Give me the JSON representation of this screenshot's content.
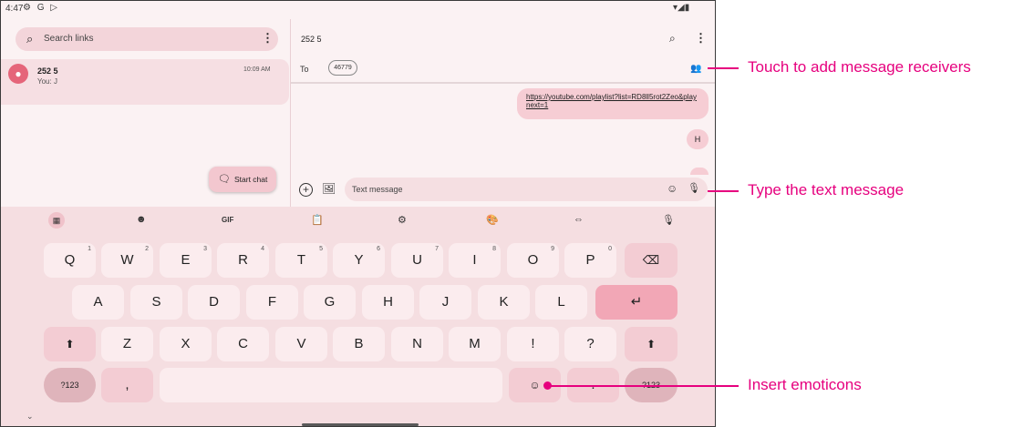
{
  "status_bar": {
    "time": "4:47",
    "left_icons": "⚙ G ▷",
    "right_icons": "▾◢▮"
  },
  "left_pane": {
    "search_placeholder": "Search links",
    "conversation": {
      "avatar_icon": "person-icon",
      "name": "252 5",
      "snippet": "You: J",
      "time": "10:09 AM"
    },
    "start_chat_label": "Start chat"
  },
  "thread": {
    "title": "252 5",
    "to_label": "To",
    "recipient": "46779",
    "messages": [
      {
        "text": "https://youtube.com/playlist?list=RD8ll5rot2Zeo&playnext=1"
      },
      {
        "text": "H"
      }
    ],
    "compose_placeholder": "Text message"
  },
  "keyboard": {
    "toolbar": {
      "gif_label": "GIF"
    },
    "row1": [
      {
        "key": "Q",
        "hint": "1"
      },
      {
        "key": "W",
        "hint": "2"
      },
      {
        "key": "E",
        "hint": "3"
      },
      {
        "key": "R",
        "hint": "4"
      },
      {
        "key": "T",
        "hint": "5"
      },
      {
        "key": "Y",
        "hint": "6"
      },
      {
        "key": "U",
        "hint": "7"
      },
      {
        "key": "I",
        "hint": "8"
      },
      {
        "key": "O",
        "hint": "9"
      },
      {
        "key": "P",
        "hint": "0"
      }
    ],
    "row2": [
      "A",
      "S",
      "D",
      "F",
      "G",
      "H",
      "J",
      "K",
      "L"
    ],
    "row3": [
      "Z",
      "X",
      "C",
      "V",
      "B",
      "N",
      "M",
      "!",
      "?"
    ],
    "symbols_label": "?123",
    "comma_label": ",",
    "period_label": ".",
    "symbols_right_label": "?123",
    "backspace_glyph": "⌫",
    "enter_glyph": "↵",
    "shift_glyph": "⬆",
    "emoji_glyph": "☺"
  },
  "annotations": {
    "add_receivers": "Touch to add message receivers",
    "type_text": "Type the text message",
    "insert_emoticons": "Insert emoticons"
  },
  "colors": {
    "accent_pink": "#e6007e",
    "avatar": "#e5657a"
  }
}
